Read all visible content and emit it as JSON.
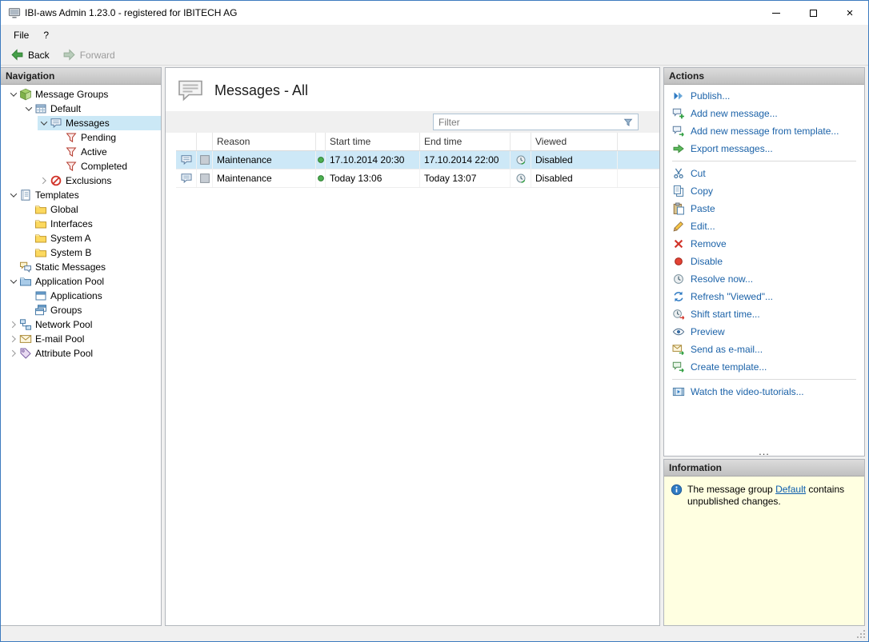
{
  "window": {
    "title": "IBI-aws Admin 1.23.0 - registered for IBITECH AG",
    "controls": [
      "minimize",
      "maximize",
      "close"
    ]
  },
  "menu": {
    "items": [
      {
        "label": "File"
      },
      {
        "label": "?"
      }
    ]
  },
  "toolbar": {
    "back_label": "Back",
    "forward_label": "Forward"
  },
  "navigation": {
    "header": "Navigation",
    "items": [
      {
        "label": "Message Groups",
        "level": 0,
        "expander": "expanded",
        "icon": "message-groups",
        "selected": false
      },
      {
        "label": "Default",
        "level": 1,
        "expander": "expanded",
        "icon": "message-group",
        "selected": false
      },
      {
        "label": "Messages",
        "level": 2,
        "expander": "expanded",
        "icon": "messages",
        "selected": true
      },
      {
        "label": "Pending",
        "level": 3,
        "expander": null,
        "icon": "filter-pending",
        "selected": false
      },
      {
        "label": "Active",
        "level": 3,
        "expander": null,
        "icon": "filter-active",
        "selected": false
      },
      {
        "label": "Completed",
        "level": 3,
        "expander": null,
        "icon": "filter-completed",
        "selected": false
      },
      {
        "label": "Exclusions",
        "level": 2,
        "expander": "collapsed",
        "icon": "exclusions",
        "selected": false
      },
      {
        "label": "Templates",
        "level": 0,
        "expander": "expanded",
        "icon": "templates",
        "selected": false
      },
      {
        "label": "Global",
        "level": 1,
        "expander": null,
        "icon": "folder",
        "selected": false
      },
      {
        "label": "Interfaces",
        "level": 1,
        "expander": null,
        "icon": "folder",
        "selected": false
      },
      {
        "label": "System A",
        "level": 1,
        "expander": null,
        "icon": "folder",
        "selected": false
      },
      {
        "label": "System B",
        "level": 1,
        "expander": null,
        "icon": "folder",
        "selected": false
      },
      {
        "label": "Static Messages",
        "level": 0,
        "expander": null,
        "icon": "static-messages",
        "selected": false
      },
      {
        "label": "Application Pool",
        "level": 0,
        "expander": "expanded",
        "icon": "application-pool",
        "selected": false
      },
      {
        "label": "Applications",
        "level": 1,
        "expander": null,
        "icon": "applications",
        "selected": false
      },
      {
        "label": "Groups",
        "level": 1,
        "expander": null,
        "icon": "groups",
        "selected": false
      },
      {
        "label": "Network Pool",
        "level": 0,
        "expander": "collapsed",
        "icon": "network-pool",
        "selected": false
      },
      {
        "label": "E-mail Pool",
        "level": 0,
        "expander": "collapsed",
        "icon": "email-pool",
        "selected": false
      },
      {
        "label": "Attribute Pool",
        "level": 0,
        "expander": "collapsed",
        "icon": "attribute-pool",
        "selected": false
      }
    ]
  },
  "main": {
    "title": "Messages - All",
    "title_icon": "messages-large",
    "filter": {
      "placeholder": "Filter",
      "icon": "filter-funnel"
    },
    "table": {
      "columns": [
        "",
        "",
        "Reason",
        "",
        "Start time",
        "End time",
        "",
        "Viewed"
      ],
      "rows": [
        {
          "reason": "Maintenance",
          "status": "green",
          "start": "17.10.2014 20:30",
          "end": "17.10.2014 22:00",
          "viewed": "Disabled",
          "selected": true
        },
        {
          "reason": "Maintenance",
          "status": "green",
          "start": "Today 13:06",
          "end": "Today 13:07",
          "viewed": "Disabled",
          "selected": false
        }
      ]
    }
  },
  "actions": {
    "header": "Actions",
    "overflow": "...",
    "items": [
      {
        "label": "Publish...",
        "icon": "publish",
        "separator_after": false
      },
      {
        "label": "Add new message...",
        "icon": "add-message",
        "separator_after": false
      },
      {
        "label": "Add new message from template...",
        "icon": "add-message-template",
        "separator_after": false
      },
      {
        "label": "Export messages...",
        "icon": "export-messages",
        "separator_after": true
      },
      {
        "label": "Cut",
        "icon": "cut",
        "separator_after": false
      },
      {
        "label": "Copy",
        "icon": "copy",
        "separator_after": false
      },
      {
        "label": "Paste",
        "icon": "paste",
        "separator_after": false
      },
      {
        "label": "Edit...",
        "icon": "edit",
        "separator_after": false
      },
      {
        "label": "Remove",
        "icon": "remove",
        "separator_after": false
      },
      {
        "label": "Disable",
        "icon": "disable",
        "separator_after": false
      },
      {
        "label": "Resolve now...",
        "icon": "resolve",
        "separator_after": false
      },
      {
        "label": "Refresh \"Viewed\"...",
        "icon": "refresh-viewed",
        "separator_after": false
      },
      {
        "label": "Shift start time...",
        "icon": "shift-start-time",
        "separator_after": false
      },
      {
        "label": "Preview",
        "icon": "preview",
        "separator_after": false
      },
      {
        "label": "Send as e-mail...",
        "icon": "send-email",
        "separator_after": false
      },
      {
        "label": "Create template...",
        "icon": "create-template",
        "separator_after": true
      },
      {
        "label": "Watch the video-tutorials...",
        "icon": "video-tutorials",
        "separator_after": false
      }
    ]
  },
  "information": {
    "header": "Information",
    "text_before": "The message group ",
    "link_label": "Default",
    "text_after": " contains unpublished changes."
  },
  "colors": {
    "action_link": "#1b62a8",
    "selection_blue": "#cbe8f6",
    "info_background": "#ffffe1",
    "panel_header_gray": "#c9c9c9",
    "status_green": "#4caf50",
    "disable_red": "#e34234"
  }
}
